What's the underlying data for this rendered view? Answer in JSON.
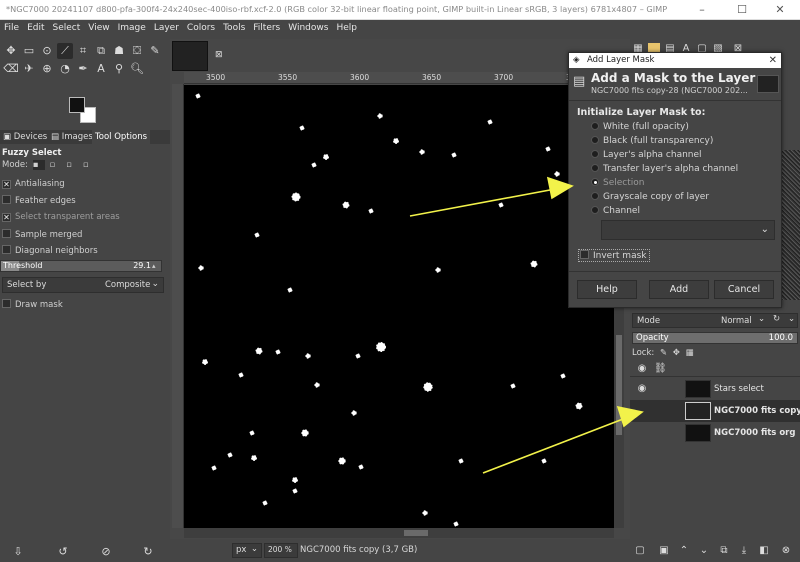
{
  "window": {
    "title": "*NGC7000 20241107 d800-pfa-300f4-24x240sec-400iso-rbf.xcf-2.0 (RGB color 32-bit linear floating point, GIMP built-in Linear sRGB, 3 layers) 6781x4807 – GIMP",
    "minimize": "–",
    "maximize": "☐",
    "close": "✕"
  },
  "menu": [
    "File",
    "Edit",
    "Select",
    "View",
    "Image",
    "Layer",
    "Colors",
    "Tools",
    "Filters",
    "Windows",
    "Help"
  ],
  "left_tabs": [
    "Devices",
    "Images",
    "Tool Options"
  ],
  "tool_options": {
    "title": "Fuzzy Select",
    "mode_label": "Mode:",
    "antialiasing": "Antialiasing",
    "feather": "Feather edges",
    "select_transparent": "Select transparent areas",
    "sample_merged": "Sample merged",
    "diagonal": "Diagonal neighbors",
    "threshold_label": "Threshold",
    "threshold_value": "29.1",
    "threshold_fraction": 0.114,
    "select_by_label": "Select by",
    "select_by_value": "Composite",
    "draw_mask": "Draw mask"
  },
  "ruler_labels": [
    "3500",
    "3550",
    "3600",
    "3650",
    "3700",
    "3750"
  ],
  "status": {
    "unit": "px",
    "zoom": "200 %",
    "info": "NGC7000 fits copy (3,7 GB)"
  },
  "dialog": {
    "window_title": "Add Layer Mask",
    "heading": "Add a Mask to the Layer",
    "subheading": "NGC7000 fits copy-28 (NGC7000 202...",
    "section": "Initialize Layer Mask to:",
    "options": [
      "White (full opacity)",
      "Black (full transparency)",
      "Layer's alpha channel",
      "Transfer layer's alpha channel",
      "Selection",
      "Grayscale copy of layer",
      "Channel"
    ],
    "selected_index": 4,
    "invert": "Invert mask",
    "help": "Help",
    "add": "Add",
    "cancel": "Cancel",
    "close": "✕"
  },
  "layers": {
    "mode_label": "Mode",
    "mode_value": "Normal",
    "opacity_label": "Opacity",
    "opacity_value": "100.0",
    "lock_label": "Lock:",
    "items": [
      "Stars select",
      "NGC7000 fits copy",
      "NGC7000 fits org"
    ]
  },
  "colors": {
    "accent_arrow": "#f2f24a",
    "dialog_title_bg": "#ffffff"
  }
}
